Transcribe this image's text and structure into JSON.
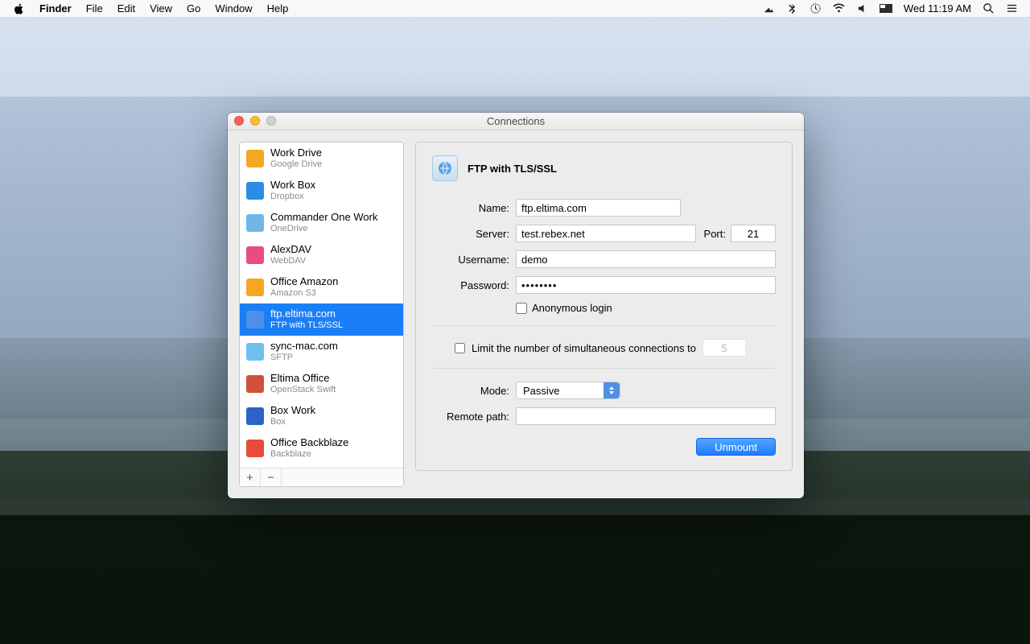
{
  "menubar": {
    "app": "Finder",
    "items": [
      "File",
      "Edit",
      "View",
      "Go",
      "Window",
      "Help"
    ],
    "clock": "Wed 11:19 AM"
  },
  "window": {
    "title": "Connections",
    "connections": [
      {
        "name": "Work Drive",
        "type": "Google Drive",
        "color": "#f5a623"
      },
      {
        "name": "Work Box",
        "type": "Dropbox",
        "color": "#2b8ce6"
      },
      {
        "name": "Commander One Work",
        "type": "OneDrive",
        "color": "#6fb7e9"
      },
      {
        "name": "AlexDAV",
        "type": "WebDAV",
        "color": "#e94b86"
      },
      {
        "name": "Office Amazon",
        "type": "Amazon S3",
        "color": "#f5a623"
      },
      {
        "name": "ftp.eltima.com",
        "type": "FTP with TLS/SSL",
        "color": "#4f8fe8"
      },
      {
        "name": "sync-mac.com",
        "type": "SFTP",
        "color": "#6fbff0"
      },
      {
        "name": "Eltima Office",
        "type": "OpenStack Swift",
        "color": "#d0503a"
      },
      {
        "name": "Box Work",
        "type": "Box",
        "color": "#2b63c8"
      },
      {
        "name": "Office Backblaze",
        "type": "Backblaze",
        "color": "#e84b3a"
      }
    ],
    "selected_index": 5,
    "detail": {
      "heading": "FTP with TLS/SSL",
      "labels": {
        "name": "Name:",
        "server": "Server:",
        "port": "Port:",
        "username": "Username:",
        "password": "Password:",
        "anonymous": "Anonymous login",
        "limit": "Limit the number of simultaneous connections to",
        "mode": "Mode:",
        "remote_path": "Remote path:"
      },
      "values": {
        "name": "ftp.eltima.com",
        "server": "test.rebex.net",
        "port": "21",
        "username": "demo",
        "password": "••••••••",
        "anonymous": false,
        "limit_enabled": false,
        "limit_value": "5",
        "mode": "Passive",
        "remote_path": ""
      },
      "action_button": "Unmount"
    }
  }
}
